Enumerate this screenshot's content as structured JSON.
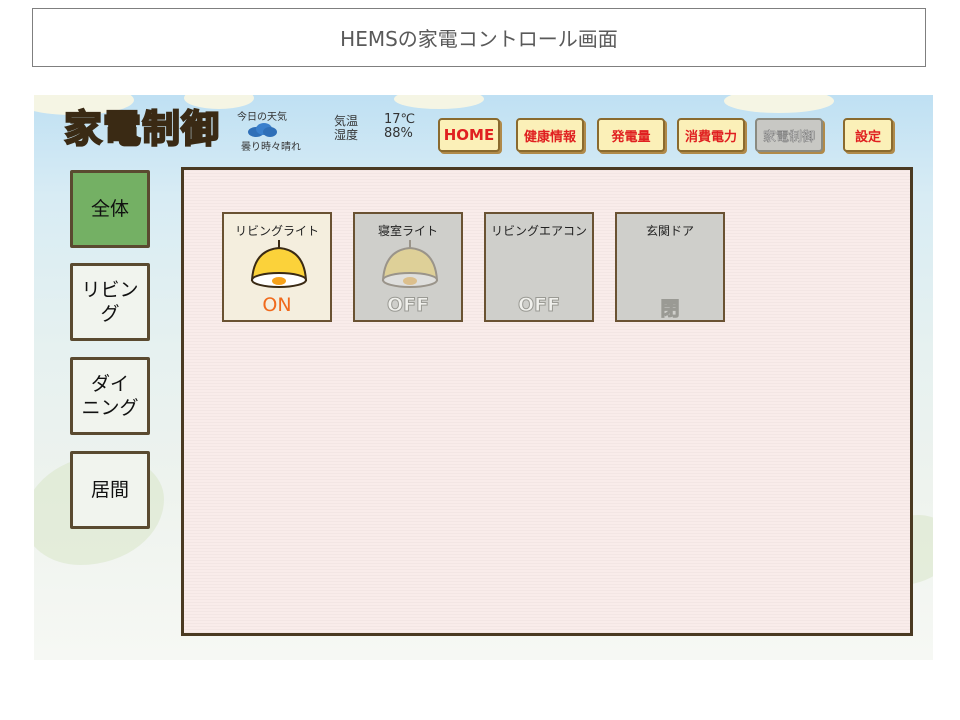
{
  "caption": "HEMSの家電コントロール画面",
  "app": {
    "logo": "家電制御",
    "weather": {
      "label": "今日の天気",
      "condition": "曇り時々晴れ",
      "icon": "cloud-icon"
    },
    "environment": {
      "temperature_label": "気温",
      "temperature": "17℃",
      "humidity_label": "湿度",
      "humidity": "88%"
    },
    "nav": [
      {
        "label": "HOME",
        "active": false
      },
      {
        "label": "健康情報",
        "active": false
      },
      {
        "label": "発電量",
        "active": false
      },
      {
        "label": "消費電力",
        "active": false
      },
      {
        "label": "家電制御",
        "active": true
      },
      {
        "label": "設定",
        "active": false
      }
    ],
    "rooms": [
      {
        "label": "全体",
        "active": true
      },
      {
        "label": "リビング",
        "active": false
      },
      {
        "label": "ダイ\nニング",
        "active": false
      },
      {
        "label": "居間",
        "active": false
      }
    ],
    "devices": [
      {
        "name": "リビングライト",
        "state": "ON",
        "on": true,
        "icon": "lamp-icon"
      },
      {
        "name": "寝室ライト",
        "state": "OFF",
        "on": false,
        "icon": "lamp-icon"
      },
      {
        "name": "リビングエアコン",
        "state": "OFF",
        "on": false,
        "icon": ""
      },
      {
        "name": "玄関ドア",
        "state": "閉",
        "on": false,
        "icon": ""
      }
    ]
  }
}
